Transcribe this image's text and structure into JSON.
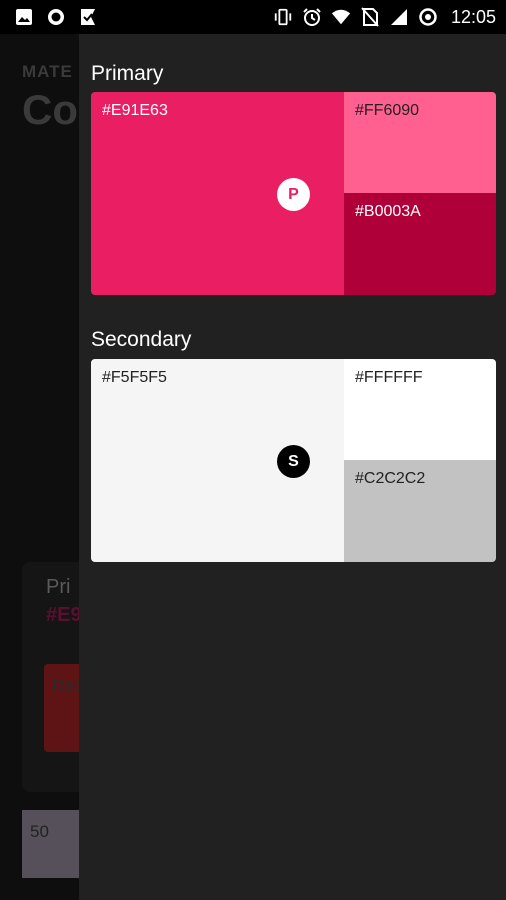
{
  "status_bar": {
    "time": "12:05",
    "left_icons": [
      "image-icon",
      "record-icon",
      "check-flag-icon"
    ],
    "right_icons": [
      "vibrate-icon",
      "alarm-icon",
      "wifi-icon",
      "no-sim-icon",
      "signal-icon",
      "data-saver-icon"
    ]
  },
  "background": {
    "overline": "MATE",
    "title": "Co",
    "card_label": "Pri",
    "card_hex": "#E9",
    "card_swatch_label": "Rec",
    "tile_label": "50"
  },
  "primary": {
    "title": "Primary",
    "main": {
      "hex": "#E91E63",
      "color": "#E91E63"
    },
    "light": {
      "hex": "#FF6090",
      "color": "#FF6090"
    },
    "dark": {
      "hex": "#B0003A",
      "color": "#B0003A"
    },
    "badge": "P"
  },
  "secondary": {
    "title": "Secondary",
    "main": {
      "hex": "#F5F5F5",
      "color": "#F5F5F5"
    },
    "light": {
      "hex": "#FFFFFF",
      "color": "#FFFFFF"
    },
    "dark": {
      "hex": "#C2C2C2",
      "color": "#C2C2C2"
    },
    "badge": "S"
  }
}
